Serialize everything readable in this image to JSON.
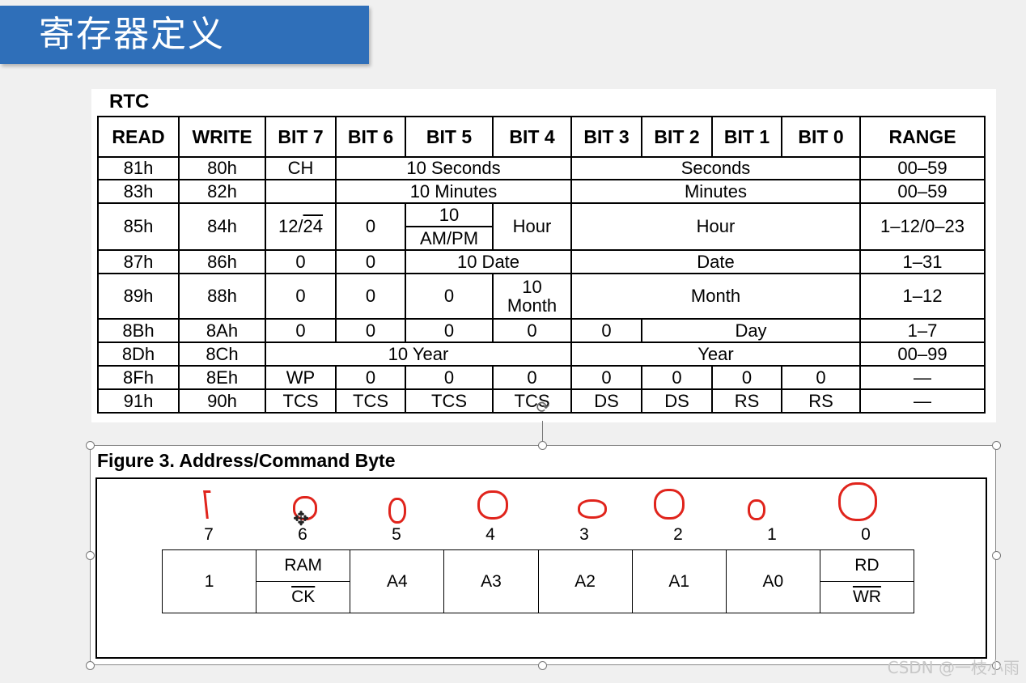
{
  "banner": {
    "title": "寄存器定义"
  },
  "rtc": {
    "label": "RTC",
    "headers": [
      "READ",
      "WRITE",
      "BIT 7",
      "BIT 6",
      "BIT 5",
      "BIT 4",
      "BIT 3",
      "BIT 2",
      "BIT 1",
      "BIT 0",
      "RANGE"
    ],
    "rows": {
      "seconds": {
        "read": "81h",
        "write": "80h",
        "bit7": "CH",
        "tens": "10 Seconds",
        "units": "Seconds",
        "range": "00–59"
      },
      "minutes": {
        "read": "83h",
        "write": "82h",
        "tens": "10 Minutes",
        "units": "Minutes",
        "range": "00–59"
      },
      "hours": {
        "read": "85h",
        "write": "84h",
        "bit7_pre": "12/",
        "bit7_over": "24",
        "bit6": "0",
        "bit5_top": "10",
        "bit5_bottom": "AM/PM",
        "bit4": "Hour",
        "units": "Hour",
        "range": "1–12/0–23"
      },
      "date": {
        "read": "87h",
        "write": "86h",
        "bit7": "0",
        "bit6": "0",
        "tens": "10 Date",
        "units": "Date",
        "range": "1–31"
      },
      "month": {
        "read": "89h",
        "write": "88h",
        "bit7": "0",
        "bit6": "0",
        "bit5": "0",
        "bit4_top": "10",
        "bit4_bottom": "Month",
        "units": "Month",
        "range": "1–12"
      },
      "day": {
        "read": "8Bh",
        "write": "8Ah",
        "bit7": "0",
        "bit6": "0",
        "bit5": "0",
        "bit4": "0",
        "bit3": "0",
        "units": "Day",
        "range": "1–7"
      },
      "year": {
        "read": "8Dh",
        "write": "8Ch",
        "tens": "10 Year",
        "units": "Year",
        "range": "00–99"
      },
      "wp": {
        "read": "8Fh",
        "write": "8Eh",
        "bit7": "WP",
        "bit6": "0",
        "bit5": "0",
        "bit4": "0",
        "bit3": "0",
        "bit2": "0",
        "bit1": "0",
        "bit0": "0",
        "range": "—"
      },
      "tcs": {
        "read": "91h",
        "write": "90h",
        "bit7": "TCS",
        "bit6": "TCS",
        "bit5": "TCS",
        "bit4": "TCS",
        "bit3": "DS",
        "bit2": "DS",
        "bit1": "RS",
        "bit0": "RS",
        "range": "—"
      }
    }
  },
  "figure": {
    "title": "Figure 3. Address/Command Byte",
    "bit_numbers": [
      "7",
      "6",
      "5",
      "4",
      "3",
      "2",
      "1",
      "0"
    ],
    "cells": {
      "b7": "1",
      "b6_top": "RAM",
      "b6_bottom": "CK",
      "b5": "A4",
      "b4": "A3",
      "b3": "A2",
      "b2": "A1",
      "b1": "A0",
      "b0_top": "RD",
      "b0_bottom": "WR"
    },
    "annotation_color": "#e0241c"
  },
  "watermark": "CSDN @一枝小雨",
  "colors": {
    "banner": "#2f6fb9"
  }
}
